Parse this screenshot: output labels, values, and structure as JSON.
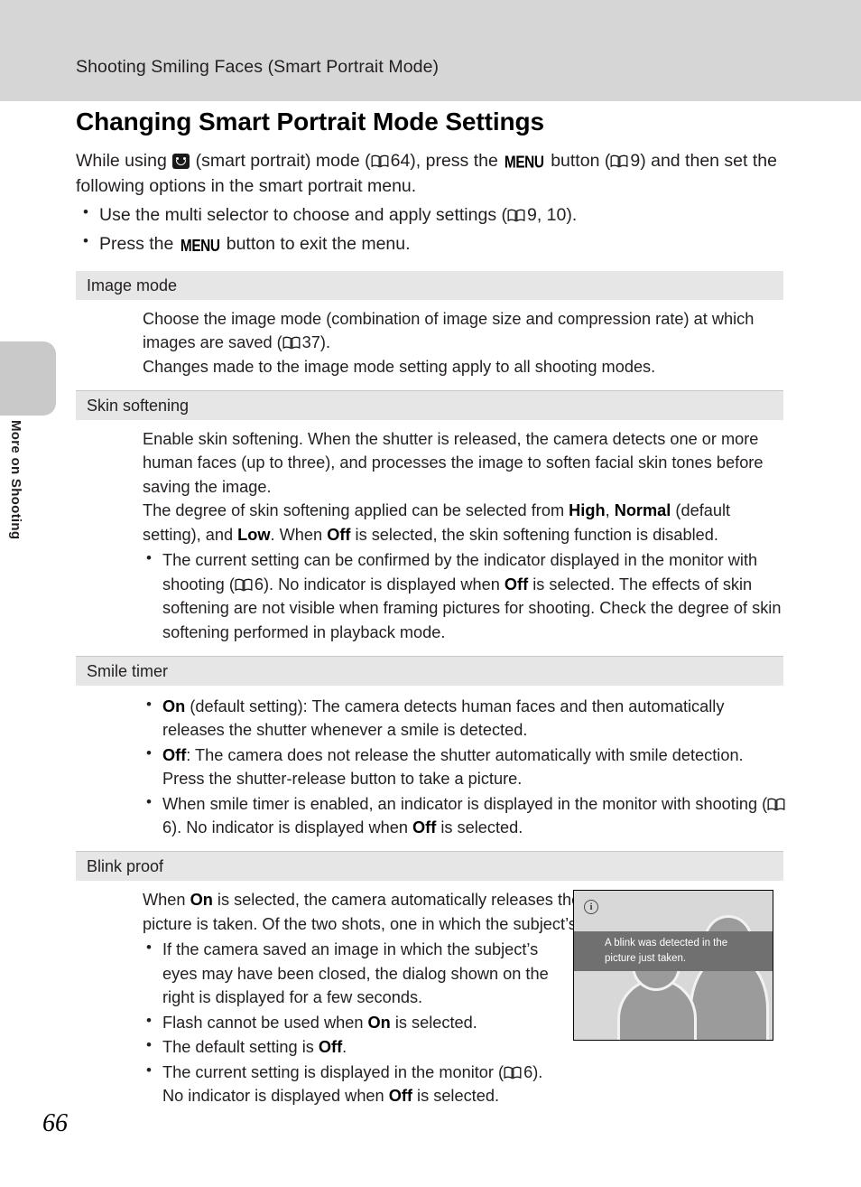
{
  "header": {
    "running_head": "Shooting Smiling Faces (Smart Portrait Mode)"
  },
  "side_tab": {
    "label": "More on Shooting"
  },
  "page_number": "66",
  "title": "Changing Smart Portrait Mode Settings",
  "intro": {
    "part1": "While using ",
    "part2": " (smart portrait) mode (",
    "ref_page_64": "64",
    "part3": "), press the ",
    "menu_label": "MENU",
    "part4": " button (",
    "ref_page_9": "9",
    "part5": ") and then set the following options in the smart portrait menu.",
    "bullets": [
      {
        "part1": "Use the multi selector to choose and apply settings (",
        "ref": "9, 10",
        "part2": ")."
      },
      {
        "part1": "Press the ",
        "menu_label": "MENU",
        "part2": " button to exit the menu."
      }
    ]
  },
  "settings": {
    "image_mode": {
      "heading": "Image mode",
      "para1_a": "Choose the image mode (combination of image size and compression rate) at which images are saved (",
      "para1_ref": "37",
      "para1_b": ").",
      "para2": "Changes made to the image mode setting apply to all shooting modes."
    },
    "skin_softening": {
      "heading": "Skin softening",
      "para1": "Enable skin softening. When the shutter is released, the camera detects one or more human faces (up to three), and processes the image to soften facial skin tones before saving the image.",
      "para2_a": "The degree of skin softening applied can be selected from ",
      "opt_high": "High",
      "para2_b": ", ",
      "opt_normal": "Normal",
      "para2_c": " (default setting), and ",
      "opt_low": "Low",
      "para2_d": ". When ",
      "opt_off": "Off",
      "para2_e": " is selected, the skin softening function is disabled.",
      "bullet1_a": "The current setting can be confirmed by the indicator displayed in the monitor with shooting (",
      "bullet1_ref": "6",
      "bullet1_b": "). No indicator is displayed when ",
      "bullet1_off": "Off",
      "bullet1_c": " is selected. The effects of skin softening are not visible when framing pictures for shooting. Check the degree of skin softening performed in playback mode."
    },
    "smile_timer": {
      "heading": "Smile timer",
      "bullet1_on": "On",
      "bullet1_text": " (default setting): The camera detects human faces and then automatically releases the shutter whenever a smile is detected.",
      "bullet2_off": "Off",
      "bullet2_text": ": The camera does not release the shutter automatically with smile detection. Press the shutter-release button to take a picture.",
      "bullet3_a": "When smile timer is enabled, an indicator is displayed in the monitor with shooting (",
      "bullet3_ref": "6",
      "bullet3_b": "). No indicator is displayed when ",
      "bullet3_off": "Off",
      "bullet3_c": " is selected."
    },
    "blink_proof": {
      "heading": "Blink proof",
      "para1_a": "When ",
      "para1_on": "On",
      "para1_b": " is selected, the camera automatically releases the shutter twice each time a picture is taken. Of the two shots, one in which the subject’s eyes are open is saved.",
      "bullet1": "If the camera saved an image in which the subject’s eyes may have been closed, the dialog shown on the right is displayed for a few seconds.",
      "bullet2_a": "Flash cannot be used when ",
      "bullet2_on": "On",
      "bullet2_b": " is selected.",
      "bullet3_a": "The default setting is ",
      "bullet3_off": "Off",
      "bullet3_b": ".",
      "bullet4_a": "The current setting is displayed in the monitor (",
      "bullet4_ref": "6",
      "bullet4_b": "). No indicator is displayed when ",
      "bullet4_off": "Off",
      "bullet4_c": " is selected."
    }
  },
  "figure": {
    "info_icon_glyph": "i",
    "message_line1": "A blink was detected in the",
    "message_line2": "picture just taken."
  },
  "colors": {
    "header_band": "#d6d6d6",
    "section_heading_band": "#e6e6e6",
    "side_tab": "#c9c9c9",
    "figure_background": "#d8d8d8",
    "figure_message_band": "#707070",
    "figure_silhouette": "#9b9b9b"
  }
}
